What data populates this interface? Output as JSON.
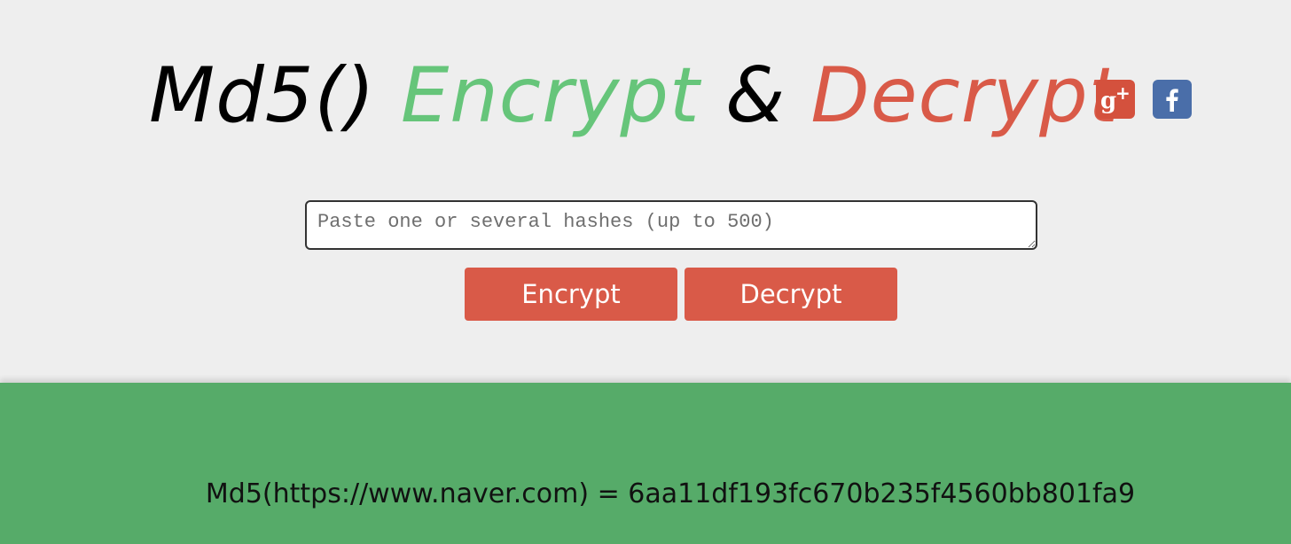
{
  "header": {
    "title_md5": "Md5()",
    "title_encrypt": "Encrypt",
    "title_amp": "&",
    "title_decrypt": "Decrypt",
    "social": [
      {
        "icon": "google-plus-icon",
        "glyph": "g+",
        "color": "#d4513d"
      },
      {
        "icon": "facebook-icon",
        "glyph": "f",
        "color": "#4a6ea9"
      }
    ]
  },
  "form": {
    "input_placeholder": "Paste one or several hashes (up to 500)",
    "input_value": "",
    "encrypt_label": "Encrypt",
    "decrypt_label": "Decrypt"
  },
  "result": {
    "text": "Md5(https://www.naver.com) = 6aa11df193fc670b235f4560bb801fa9"
  },
  "colors": {
    "accent_green": "#66c57a",
    "accent_red": "#d95a48",
    "band_green": "#56ab69",
    "background": "#eeeeee"
  }
}
